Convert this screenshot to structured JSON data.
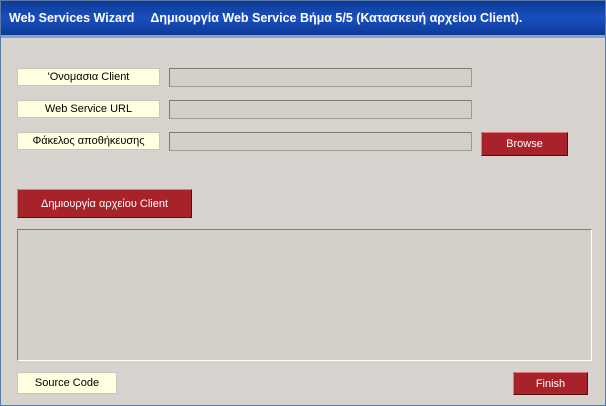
{
  "window": {
    "title_left": "Web Services Wizard",
    "title_right": "Δημιουργία  Web Service Βήμα 5/5   (Κατασκευή αρχείου Client)."
  },
  "form": {
    "client_name_label": "'Ονομασια Client",
    "client_name_value": "",
    "url_label": "Web Service URL",
    "url_value": "",
    "folder_label": "Φάκελος αποθήκευσης",
    "folder_value": "",
    "browse_label": "Browse"
  },
  "actions": {
    "create_client_label": "Δημιουργία αρχείου Client",
    "finish_label": "Finish"
  },
  "output": {
    "source_code_label": "Source Code",
    "content": ""
  }
}
